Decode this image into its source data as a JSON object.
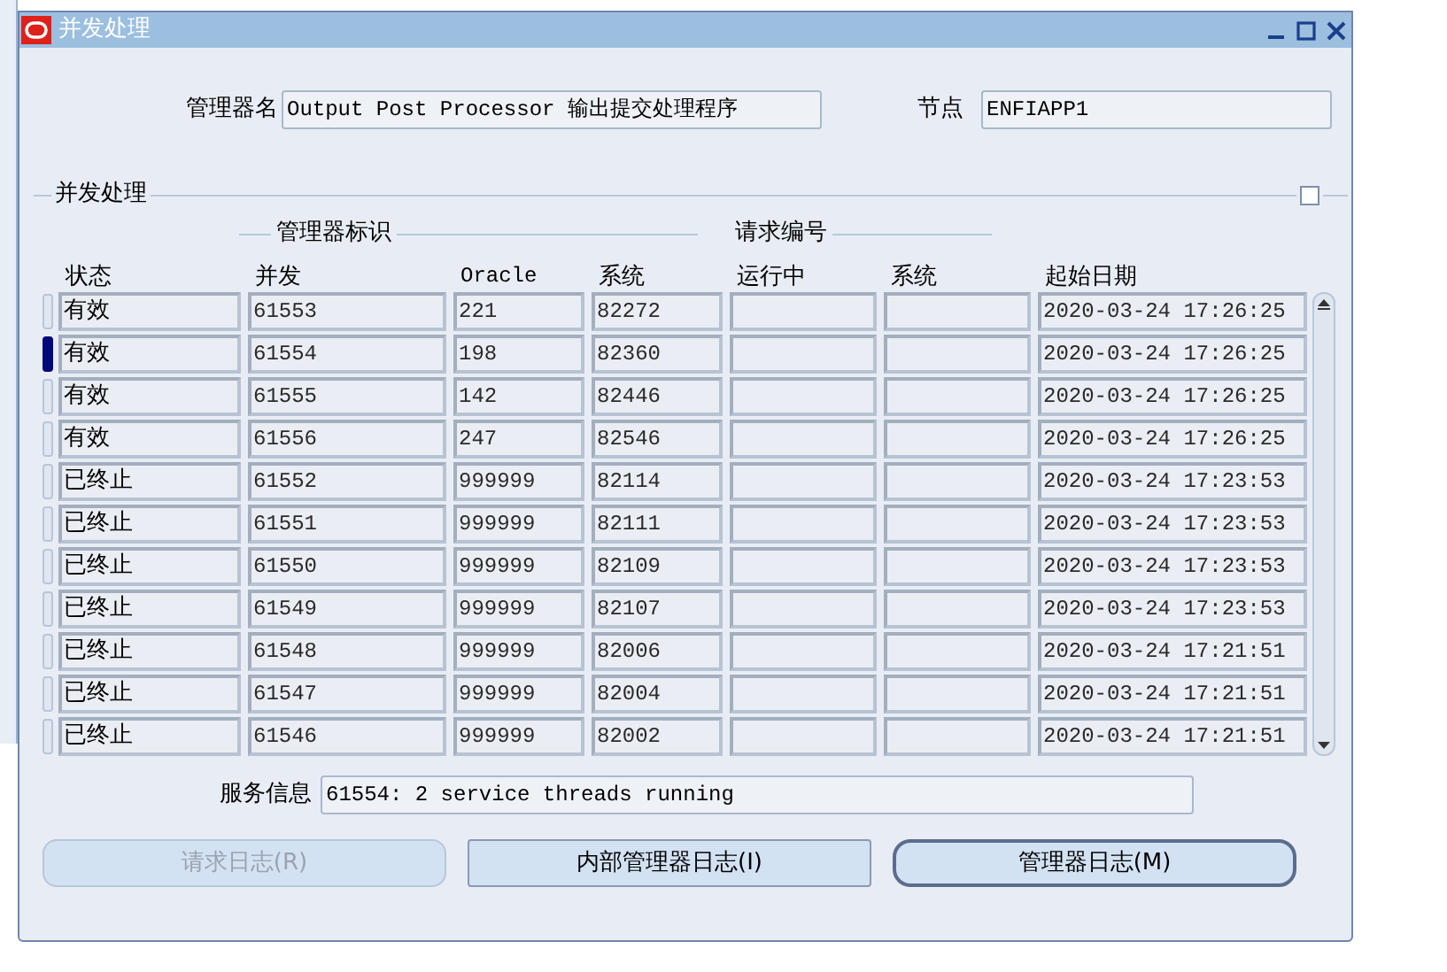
{
  "window": {
    "title": "并发处理"
  },
  "manager_name": {
    "label": "管理器名",
    "value": "Output Post Processor 输出提交处理程序"
  },
  "node": {
    "label": "节点",
    "value": "ENFIAPP1"
  },
  "section": {
    "title": "并发处理",
    "checked": false
  },
  "group_headers": [
    "管理器标识",
    "请求编号"
  ],
  "table": {
    "columns": [
      "状态",
      "并发",
      "Oracle",
      "系统",
      "运行中",
      "系统",
      "起始日期"
    ],
    "rows": [
      {
        "selected": false,
        "cells": [
          "有效",
          "61553",
          "221",
          "82272",
          "",
          "",
          "2020-03-24 17:26:25"
        ]
      },
      {
        "selected": true,
        "cells": [
          "有效",
          "61554",
          "198",
          "82360",
          "",
          "",
          "2020-03-24 17:26:25"
        ]
      },
      {
        "selected": false,
        "cells": [
          "有效",
          "61555",
          "142",
          "82446",
          "",
          "",
          "2020-03-24 17:26:25"
        ]
      },
      {
        "selected": false,
        "cells": [
          "有效",
          "61556",
          "247",
          "82546",
          "",
          "",
          "2020-03-24 17:26:25"
        ]
      },
      {
        "selected": false,
        "cells": [
          "已终止",
          "61552",
          "999999",
          "82114",
          "",
          "",
          "2020-03-24 17:23:53"
        ]
      },
      {
        "selected": false,
        "cells": [
          "已终止",
          "61551",
          "999999",
          "82111",
          "",
          "",
          "2020-03-24 17:23:53"
        ]
      },
      {
        "selected": false,
        "cells": [
          "已终止",
          "61550",
          "999999",
          "82109",
          "",
          "",
          "2020-03-24 17:23:53"
        ]
      },
      {
        "selected": false,
        "cells": [
          "已终止",
          "61549",
          "999999",
          "82107",
          "",
          "",
          "2020-03-24 17:23:53"
        ]
      },
      {
        "selected": false,
        "cells": [
          "已终止",
          "61548",
          "999999",
          "82006",
          "",
          "",
          "2020-03-24 17:21:51"
        ]
      },
      {
        "selected": false,
        "cells": [
          "已终止",
          "61547",
          "999999",
          "82004",
          "",
          "",
          "2020-03-24 17:21:51"
        ]
      },
      {
        "selected": false,
        "cells": [
          "已终止",
          "61546",
          "999999",
          "82002",
          "",
          "",
          "2020-03-24 17:21:51"
        ]
      }
    ]
  },
  "service_info": {
    "label": "服务信息",
    "value": "61554: 2 service threads running"
  },
  "buttons": [
    {
      "label": "请求日志(R)",
      "disabled": true,
      "default": false
    },
    {
      "label": "内部管理器日志(I)",
      "disabled": false,
      "default": false
    },
    {
      "label": "管理器日志(M)",
      "disabled": false,
      "default": true
    }
  ]
}
